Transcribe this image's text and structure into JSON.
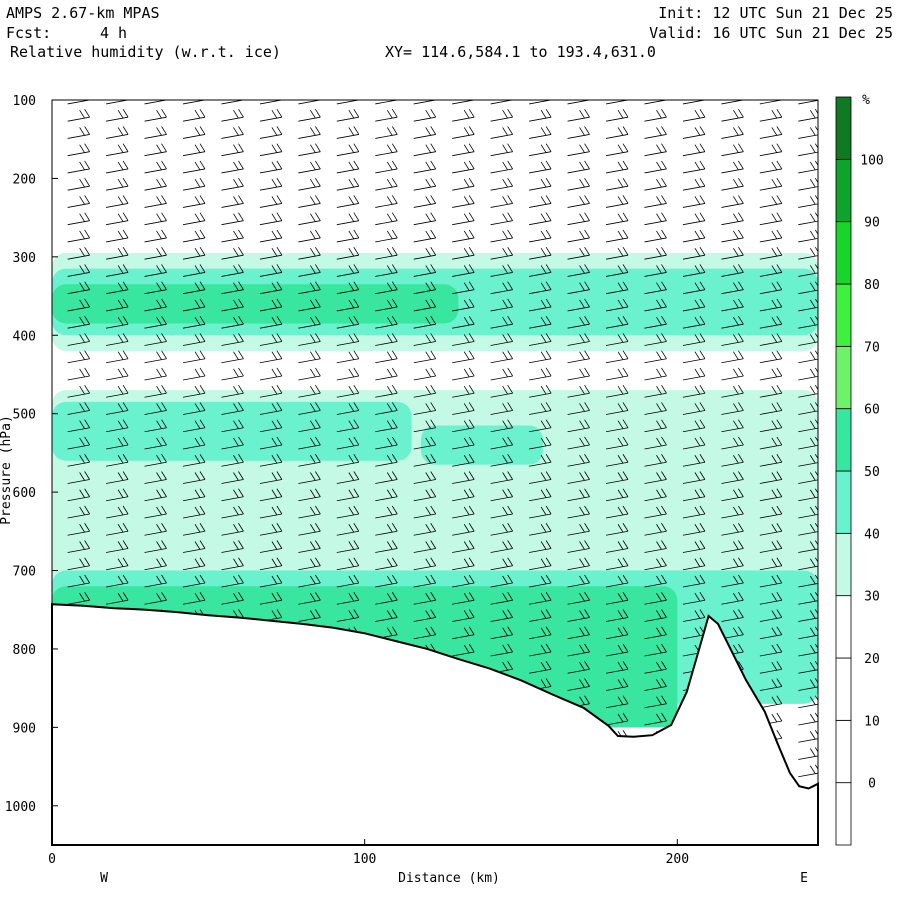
{
  "header": {
    "model": "AMPS 2.67-km MPAS",
    "fcst_label": "Fcst:",
    "fcst_value": "4 h",
    "field": "Relative humidity (w.r.t. ice)",
    "xy": "XY= 114.6,584.1 to 193.4,631.0",
    "init": "Init: 12 UTC Sun 21 Dec 25",
    "valid": "Valid: 16 UTC Sun 21 Dec 25"
  },
  "chart_data": {
    "type": "heatmap",
    "title": "Relative humidity (w.r.t. ice)",
    "xlabel": "Distance (km)",
    "ylabel": "Pressure (hPa)",
    "x_end_labels": [
      "W",
      "E"
    ],
    "xlim": [
      0,
      245
    ],
    "ylim": [
      1050,
      100
    ],
    "xticks": [
      "0",
      "100",
      "200"
    ],
    "xtick_values": [
      0,
      100,
      200
    ],
    "yticks": [
      "100",
      "200",
      "300",
      "400",
      "500",
      "600",
      "700",
      "800",
      "900",
      "1000"
    ],
    "ytick_values": [
      100,
      200,
      300,
      400,
      500,
      600,
      700,
      800,
      900,
      1000
    ],
    "colorbar": {
      "unit": "%",
      "labels": [
        "0",
        "10",
        "20",
        "30",
        "40",
        "50",
        "60",
        "70",
        "80",
        "90",
        "100"
      ],
      "levels": [
        -10,
        0,
        10,
        20,
        30,
        40,
        50,
        60,
        70,
        80,
        90,
        100,
        110
      ],
      "colors": [
        "#ffffff",
        "#ffffff",
        "#ffffff",
        "#ffffff",
        "#c4f9e6",
        "#6af2cf",
        "#39e6a0",
        "#6ff26a",
        "#3ff040",
        "#19d42b",
        "#10a32c",
        "#0f7a21",
        "#4a5e0e"
      ]
    },
    "terrain": [
      [
        0,
        743
      ],
      [
        10,
        745
      ],
      [
        20,
        748
      ],
      [
        30,
        750
      ],
      [
        40,
        753
      ],
      [
        50,
        757
      ],
      [
        60,
        760
      ],
      [
        70,
        764
      ],
      [
        80,
        768
      ],
      [
        90,
        773
      ],
      [
        100,
        780
      ],
      [
        110,
        790
      ],
      [
        120,
        800
      ],
      [
        130,
        813
      ],
      [
        140,
        825
      ],
      [
        150,
        840
      ],
      [
        160,
        858
      ],
      [
        170,
        875
      ],
      [
        178,
        898
      ],
      [
        181,
        911
      ],
      [
        186,
        912
      ],
      [
        192,
        910
      ],
      [
        198,
        897
      ],
      [
        203,
        855
      ],
      [
        207,
        800
      ],
      [
        210,
        758
      ],
      [
        213,
        768
      ],
      [
        217,
        800
      ],
      [
        222,
        840
      ],
      [
        228,
        880
      ],
      [
        232,
        920
      ],
      [
        236,
        958
      ],
      [
        239,
        975
      ],
      [
        242,
        978
      ],
      [
        245,
        972
      ]
    ],
    "rh_layers": [
      {
        "level": 30,
        "x": [
          0,
          245
        ],
        "p_top": 295,
        "p_bot": 420
      },
      {
        "level": 40,
        "x": [
          0,
          245
        ],
        "p_top": 315,
        "p_bot": 400
      },
      {
        "level": 50,
        "x": [
          0,
          130
        ],
        "p_top": 335,
        "p_bot": 385
      },
      {
        "level": 30,
        "x": [
          0,
          245
        ],
        "p_top": 470,
        "p_bot": 760
      },
      {
        "level": 40,
        "x": [
          0,
          115
        ],
        "p_top": 485,
        "p_bot": 560
      },
      {
        "level": 40,
        "x": [
          118,
          157
        ],
        "p_top": 515,
        "p_bot": 565
      },
      {
        "level": 40,
        "x": [
          0,
          245
        ],
        "p_top": 700,
        "p_bot": 870
      },
      {
        "level": 50,
        "x": [
          0,
          200
        ],
        "p_top": 720,
        "p_bot": 900
      }
    ]
  }
}
